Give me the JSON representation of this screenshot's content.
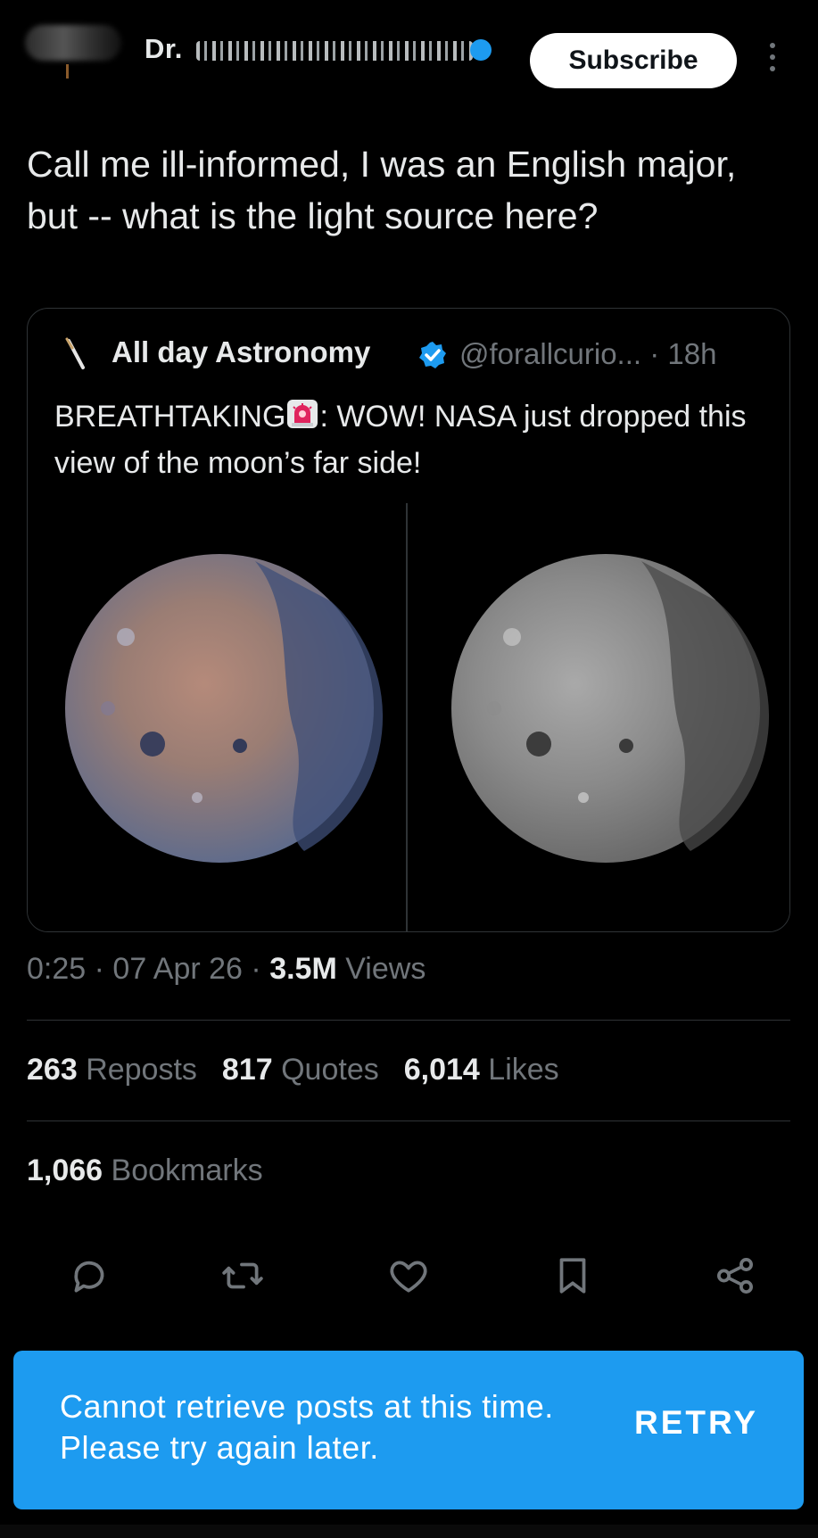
{
  "header": {
    "author_prefix": "Dr.",
    "subscribe_label": "Subscribe"
  },
  "post": {
    "text": "Call me ill-informed, I was an English major, but -- what is the light source here?"
  },
  "quote": {
    "name": "All day Astronomy",
    "handle": "@forallcurio...",
    "age": "· 18h",
    "text_before": "BREATHTAKING",
    "text_after": ": WOW! NASA just dropped this view of the moon’s far side!"
  },
  "meta": {
    "time": "0:25",
    "date": "07 Apr 26",
    "views_count": "3.5M",
    "views_label": "Views"
  },
  "stats": {
    "reposts_count": "263",
    "reposts_label": "Reposts",
    "quotes_count": "817",
    "quotes_label": "Quotes",
    "likes_count": "6,014",
    "likes_label": "Likes",
    "bookmarks_count": "1,066",
    "bookmarks_label": "Bookmarks"
  },
  "toast": {
    "message": "Cannot retrieve posts at this time. Please try again later.",
    "retry_label": "RETRY"
  },
  "colors": {
    "accent": "#1d9bf0",
    "muted": "#71767b",
    "border": "#2f3336"
  }
}
